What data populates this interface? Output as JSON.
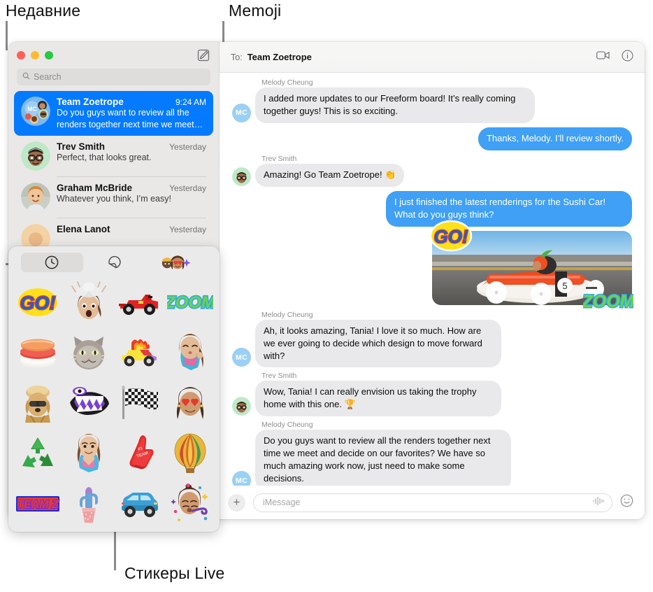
{
  "callouts": [
    {
      "id": "recents",
      "label": "Недавние"
    },
    {
      "id": "memoji",
      "label": "Memoji"
    },
    {
      "id": "live_stickers",
      "label": "Стикеры Live"
    }
  ],
  "window": {
    "traffic_lights": [
      "close",
      "minimize",
      "zoom"
    ],
    "compose_icon": "compose-icon"
  },
  "sidebar": {
    "search": {
      "placeholder": "Search",
      "icon": "search-icon"
    },
    "conversations": [
      {
        "name": "Team Zoetrope",
        "time": "9:24 AM",
        "preview": "Do you guys want to review all the renders together next time we meet…",
        "selected": true,
        "avatar": "group-avatar"
      },
      {
        "name": "Trev Smith",
        "time": "Yesterday",
        "preview": "Perfect, that looks great.",
        "selected": false,
        "avatar": "memoji-avatar-trev"
      },
      {
        "name": "Graham McBride",
        "time": "Yesterday",
        "preview": "Whatever you think, I’m easy!",
        "selected": false,
        "avatar": "photo-avatar-graham"
      },
      {
        "name": "Elena Lanot",
        "time": "Yesterday",
        "preview": "",
        "selected": false,
        "avatar": "photo-avatar-elena"
      }
    ]
  },
  "chat": {
    "to_label": "To:",
    "to_value": "Team Zoetrope",
    "actions": [
      {
        "name": "facetime-video-button",
        "icon": "video-camera-icon"
      },
      {
        "name": "details-button",
        "icon": "info-circle-icon"
      }
    ],
    "messages": [
      {
        "dir": "in",
        "sender": "Melody Cheung",
        "avatar_initials": "MC",
        "text": "I added more updates to our Freeform board! It’s really coming together guys! This is so exciting."
      },
      {
        "dir": "out",
        "sender": "",
        "text": "Thanks, Melody. I’ll review shortly."
      },
      {
        "dir": "in",
        "sender": "Trev Smith",
        "avatar_initials": "",
        "text": "Amazing! Go Team Zoetrope! 👏"
      },
      {
        "dir": "out",
        "sender": "",
        "text": "I just finished the latest renderings for the Sushi Car! What do you guys think?"
      },
      {
        "dir": "out",
        "type": "photo",
        "alt": "Sushi soapbox derby race car photo",
        "stickers": [
          "GO!",
          "ZOOM"
        ]
      },
      {
        "dir": "in",
        "sender": "Melody Cheung",
        "avatar_initials": "MC",
        "text": "Ah, it looks amazing, Tania! I love it so much. How are we ever going to decide which design to move forward with?"
      },
      {
        "dir": "in",
        "sender": "Trev Smith",
        "avatar_initials": "",
        "text": "Wow, Tania! I can really envision us taking the trophy home with this one. 🏆"
      },
      {
        "dir": "in",
        "sender": "Melody Cheung",
        "avatar_initials": "MC",
        "text": "Do you guys want to review all the renders together next time we meet and decide on our favorites? We have so much amazing work now, just need to make some decisions."
      }
    ],
    "input": {
      "add_icon": "plus-icon",
      "placeholder": "iMessage",
      "audio_icon": "audio-waveform-icon",
      "emoji_icon": "smiley-face-icon"
    }
  },
  "sticker_popover": {
    "tabs": [
      {
        "name": "recents-tab",
        "icon": "clock-icon",
        "active": true
      },
      {
        "name": "live-stickers-tab",
        "icon": "sticker-peel-icon",
        "active": false
      },
      {
        "name": "memoji-tab",
        "icon": "memoji-faces-icon",
        "active": false
      }
    ],
    "stickers": [
      {
        "name": "go-text-sticker",
        "kind": "go"
      },
      {
        "name": "mind-blown-memoji-sticker",
        "kind": "memoji-mindblown"
      },
      {
        "name": "race-car-sticker",
        "kind": "racecar"
      },
      {
        "name": "zoom-text-sticker",
        "kind": "zoom"
      },
      {
        "name": "sushi-sticker",
        "kind": "sushi"
      },
      {
        "name": "grumpy-cat-sticker",
        "kind": "cat"
      },
      {
        "name": "flaming-car-sticker",
        "kind": "flamecar"
      },
      {
        "name": "memoji-kiss-sticker",
        "kind": "memoji-kiss"
      },
      {
        "name": "dog-in-sunglasses-sticker",
        "kind": "dog"
      },
      {
        "name": "monster-mouth-sticker",
        "kind": "monster"
      },
      {
        "name": "checkered-flag-sticker",
        "kind": "flag"
      },
      {
        "name": "heart-eyes-memoji-sticker",
        "kind": "memoji-hearts"
      },
      {
        "name": "recycle-sticker",
        "kind": "recycle"
      },
      {
        "name": "heart-hands-memoji-sticker",
        "kind": "memoji-hearthands"
      },
      {
        "name": "foam-finger-sticker",
        "kind": "foamfinger"
      },
      {
        "name": "hot-air-balloon-sticker",
        "kind": "balloon"
      },
      {
        "name": "team-z-text-sticker",
        "kind": "teamz"
      },
      {
        "name": "cactus-sticker",
        "kind": "cactus"
      },
      {
        "name": "blue-car-sticker",
        "kind": "bluecar"
      },
      {
        "name": "party-memoji-sticker",
        "kind": "memoji-party"
      }
    ]
  },
  "colors": {
    "accent_blue": "#047aff",
    "bubble_blue": "#3fa0f5",
    "bubble_grey": "#e9e9eb",
    "sidebar_bg": "#e9e8e7",
    "popover_bg": "#ebeaea"
  }
}
